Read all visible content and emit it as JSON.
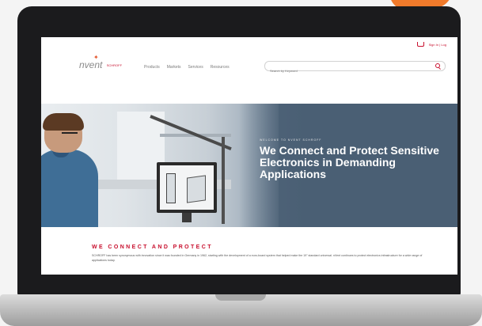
{
  "utility": {
    "sign_in": "Sign In | Log"
  },
  "header": {
    "logo_main": "nvent",
    "logo_sub": "SCHROFF",
    "nav": [
      "Products",
      "Markets",
      "Services",
      "Resources"
    ],
    "search_placeholder": "Search by Keyword"
  },
  "hero": {
    "eyebrow": "WELCOME TO NVENT SCHROFF",
    "title": "We Connect and Protect Sensitive Electronics in Demanding Applications"
  },
  "section": {
    "title": "WE CONNECT AND PROTECT",
    "body": "SCHROFF has been synonymous with innovation since it was founded in Germany in 1962, starting with the development of a euro-board system that helped make the 19\" standard universal. nVent continues to protect electronics infrastructure for a wide range of applications today."
  },
  "colors": {
    "brand_red": "#c8102e",
    "hero_bg": "#4a5f74",
    "accent_orange": "#f07a2b"
  }
}
